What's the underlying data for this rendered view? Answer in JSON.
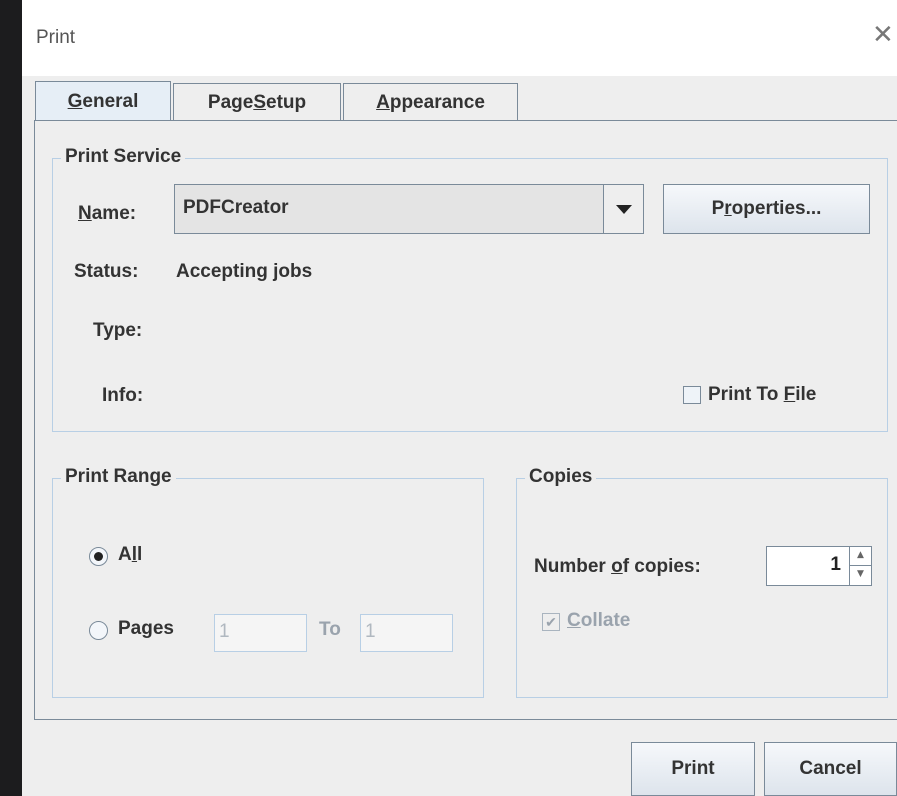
{
  "window": {
    "title": "Print"
  },
  "tabs": [
    {
      "prefix": "",
      "mnemonic": "G",
      "suffix": "eneral"
    },
    {
      "prefix": "Page ",
      "mnemonic": "S",
      "suffix": "etup"
    },
    {
      "prefix": "",
      "mnemonic": "A",
      "suffix": "ppearance"
    }
  ],
  "print_service": {
    "legend": "Print Service",
    "name_label": {
      "prefix": "",
      "mnemonic": "N",
      "suffix": "ame:"
    },
    "name_value": "PDFCreator",
    "properties_button": {
      "prefix": "P",
      "mnemonic": "r",
      "suffix": "operties..."
    },
    "status_label": "Status:",
    "status_value": "Accepting jobs",
    "type_label": "Type:",
    "info_label": "Info:",
    "print_to_file": {
      "prefix": "Print To ",
      "mnemonic": "F",
      "suffix": "ile",
      "checked": false
    }
  },
  "print_range": {
    "legend": "Print Range",
    "all": {
      "prefix": "A",
      "mnemonic": "l",
      "suffix": "l",
      "selected": true
    },
    "pages": {
      "prefix": "Pa",
      "mnemonic": "g",
      "suffix": "es",
      "selected": false
    },
    "from_value": "1",
    "to_label": "To",
    "to_value": "1"
  },
  "copies": {
    "legend": "Copies",
    "number_label": {
      "prefix": "Number ",
      "mnemonic": "o",
      "suffix": "f copies:"
    },
    "number_value": "1",
    "collate": {
      "prefix": "",
      "mnemonic": "C",
      "suffix": "ollate",
      "checked": true,
      "enabled": false
    }
  },
  "buttons": {
    "print": "Print",
    "cancel": "Cancel"
  }
}
